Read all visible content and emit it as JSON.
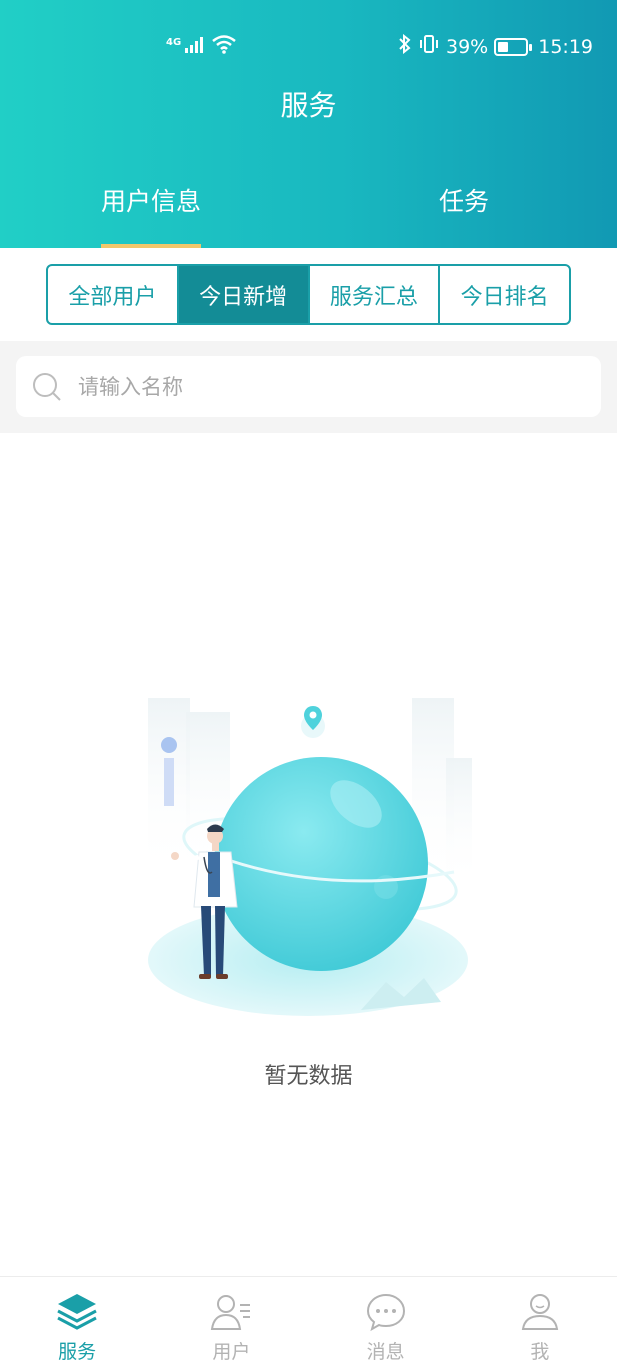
{
  "status_bar": {
    "network": "4G",
    "battery_percent": "39%",
    "battery_level": 0.39,
    "time": "15:19"
  },
  "header": {
    "title": "服务",
    "tabs": [
      {
        "label": "用户信息",
        "active": true
      },
      {
        "label": "任务",
        "active": false
      }
    ]
  },
  "segments": [
    {
      "label": "全部用户",
      "active": false
    },
    {
      "label": "今日新增",
      "active": true
    },
    {
      "label": "服务汇总",
      "active": false
    },
    {
      "label": "今日排名",
      "active": false
    }
  ],
  "search": {
    "placeholder": "请输入名称",
    "value": ""
  },
  "empty_state": {
    "text": "暂无数据"
  },
  "bottom_nav": [
    {
      "label": "服务",
      "icon": "layers-icon",
      "active": true
    },
    {
      "label": "用户",
      "icon": "user-list-icon",
      "active": false
    },
    {
      "label": "消息",
      "icon": "chat-bubble-icon",
      "active": false
    },
    {
      "label": "我",
      "icon": "profile-icon",
      "active": false
    }
  ],
  "colors": {
    "header_gradient_start": "#21cfc6",
    "header_gradient_end": "#1199b3",
    "accent": "#1a9fa8",
    "segment_active": "#138c96",
    "tab_indicator": "#f2c76b",
    "nav_inactive": "#b3b3b3"
  }
}
